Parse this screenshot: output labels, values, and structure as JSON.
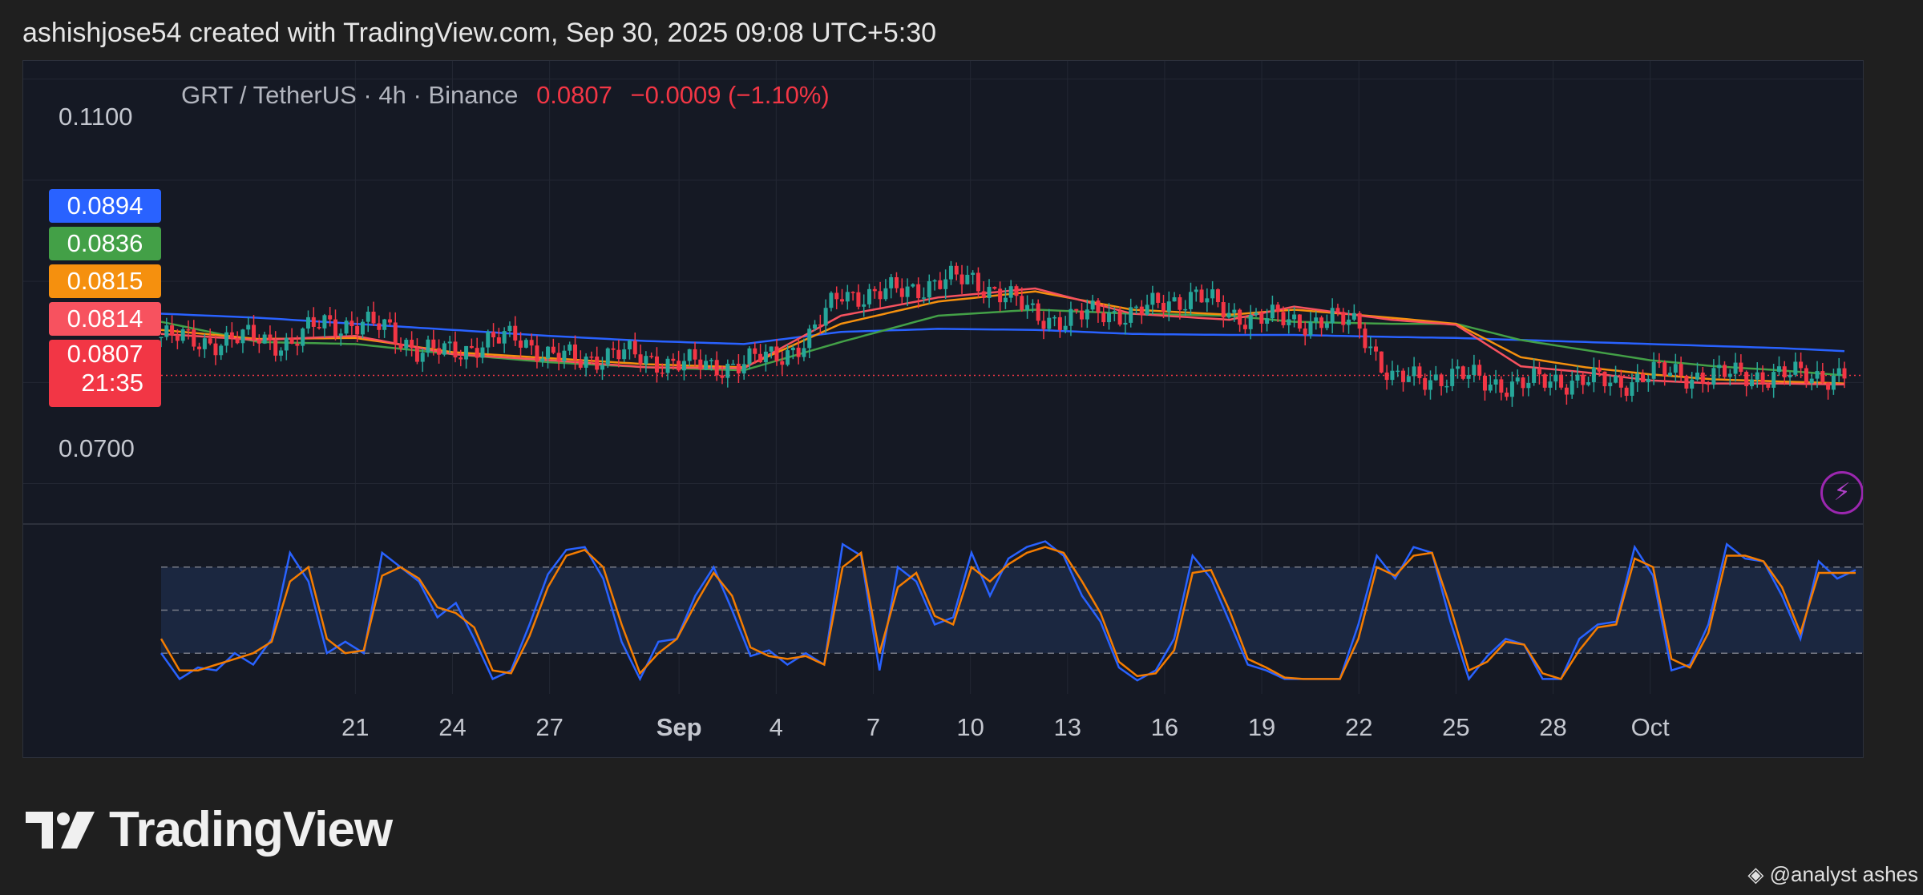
{
  "header": {
    "text": "ashishjose54 created with TradingView.com, Sep 30, 2025 09:08 UTC+5:30"
  },
  "legend": {
    "symbol": "GRT / TetherUS · 4h · Binance",
    "price": "0.0807",
    "change": "−0.0009 (−1.10%)"
  },
  "price_tags": [
    {
      "value": "0.0894",
      "color": "#2962ff"
    },
    {
      "value": "0.0836",
      "color": "#43a047"
    },
    {
      "value": "0.0815",
      "color": "#f5900e"
    },
    {
      "value": "0.0814",
      "color": "#f7525f"
    },
    {
      "value": "0.0807",
      "color": "#f23645"
    }
  ],
  "countdown": "21:35",
  "brand": {
    "name": "TradingView"
  },
  "credit": {
    "text": "@analyst ashes"
  },
  "icons": {
    "logo": "tradingview-logo-icon",
    "bolt": "lightning-icon",
    "credit": "binance-diamond-icon"
  },
  "colors": {
    "up": "#26a69a",
    "down": "#f23645",
    "k_line": "#2962ff",
    "d_line": "#f57c00"
  },
  "chart_data": [
    {
      "type": "candlestick",
      "title": "GRT / TetherUS · 4h · Binance",
      "x_ticks": [
        "21",
        "24",
        "27",
        "Sep",
        "4",
        "7",
        "10",
        "13",
        "16",
        "19",
        "22",
        "25",
        "28",
        "Oct"
      ],
      "x_ticks_bold": [
        "Sep"
      ],
      "y_ticks": [
        "0.1100",
        "0.0700"
      ],
      "ylim": [
        0.066,
        0.1118
      ],
      "last_price": 0.0807,
      "series": [
        {
          "name": "",
          "color": "#2962ff",
          "points": [
            [
              0,
              0.0868
            ],
            [
              3,
              0.0864
            ],
            [
              6,
              0.0858
            ],
            [
              9,
              0.0852
            ],
            [
              12,
              0.0846
            ],
            [
              15,
              0.0841
            ],
            [
              18,
              0.0838
            ],
            [
              21,
              0.085
            ],
            [
              24,
              0.0853
            ],
            [
              27,
              0.0852
            ],
            [
              30,
              0.0848
            ],
            [
              33,
              0.0847
            ],
            [
              35,
              0.0847
            ],
            [
              38,
              0.0845
            ],
            [
              40,
              0.0844
            ],
            [
              42,
              0.0842
            ],
            [
              44,
              0.084
            ],
            [
              46,
              0.0838
            ],
            [
              48,
              0.0836
            ],
            [
              50,
              0.0834
            ],
            [
              52,
              0.0831
            ]
          ]
        },
        {
          "name": "",
          "color": "#43a047",
          "points": [
            [
              0,
              0.086
            ],
            [
              3,
              0.084
            ],
            [
              6,
              0.0838
            ],
            [
              9,
              0.0828
            ],
            [
              12,
              0.082
            ],
            [
              15,
              0.0815
            ],
            [
              18,
              0.0812
            ],
            [
              21,
              0.084
            ],
            [
              24,
              0.0866
            ],
            [
              27,
              0.0872
            ],
            [
              30,
              0.0868
            ],
            [
              33,
              0.0866
            ],
            [
              35,
              0.086
            ],
            [
              38,
              0.0858
            ],
            [
              40,
              0.0858
            ],
            [
              42,
              0.0842
            ],
            [
              44,
              0.0832
            ],
            [
              46,
              0.0822
            ],
            [
              48,
              0.0816
            ],
            [
              50,
              0.0812
            ],
            [
              52,
              0.0807
            ]
          ]
        },
        {
          "name": "",
          "color": "#f5900e",
          "points": [
            [
              0,
              0.0852
            ],
            [
              3,
              0.0843
            ],
            [
              6,
              0.0844
            ],
            [
              9,
              0.083
            ],
            [
              12,
              0.0824
            ],
            [
              15,
              0.0818
            ],
            [
              18,
              0.0815
            ],
            [
              21,
              0.0858
            ],
            [
              24,
              0.088
            ],
            [
              27,
              0.089
            ],
            [
              30,
              0.0872
            ],
            [
              33,
              0.0867
            ],
            [
              35,
              0.0872
            ],
            [
              38,
              0.0864
            ],
            [
              40,
              0.0858
            ],
            [
              42,
              0.0825
            ],
            [
              44,
              0.0815
            ],
            [
              46,
              0.0808
            ],
            [
              48,
              0.0803
            ],
            [
              50,
              0.0801
            ],
            [
              52,
              0.0799
            ]
          ]
        },
        {
          "name": "",
          "color": "#f7525f",
          "points": [
            [
              0,
              0.0848
            ],
            [
              3,
              0.0842
            ],
            [
              6,
              0.0846
            ],
            [
              9,
              0.0828
            ],
            [
              12,
              0.0822
            ],
            [
              15,
              0.0815
            ],
            [
              18,
              0.0814
            ],
            [
              21,
              0.0866
            ],
            [
              24,
              0.0884
            ],
            [
              27,
              0.0893
            ],
            [
              30,
              0.0868
            ],
            [
              33,
              0.0862
            ],
            [
              35,
              0.0875
            ],
            [
              38,
              0.0862
            ],
            [
              40,
              0.0857
            ],
            [
              42,
              0.0816
            ],
            [
              44,
              0.081
            ],
            [
              46,
              0.0802
            ],
            [
              48,
              0.0799
            ],
            [
              50,
              0.0799
            ],
            [
              52,
              0.0798
            ]
          ]
        }
      ],
      "candles_close": [
        [
          0,
          0.0845
        ],
        [
          1,
          0.0842
        ],
        [
          2,
          0.084
        ],
        [
          3,
          0.0846
        ],
        [
          4,
          0.0836
        ],
        [
          5,
          0.0862
        ],
        [
          6,
          0.0855
        ],
        [
          7,
          0.0856
        ],
        [
          8,
          0.0828
        ],
        [
          9,
          0.0832
        ],
        [
          10,
          0.0838
        ],
        [
          11,
          0.0846
        ],
        [
          12,
          0.0826
        ],
        [
          13,
          0.0822
        ],
        [
          14,
          0.083
        ],
        [
          15,
          0.0822
        ],
        [
          16,
          0.082
        ],
        [
          17,
          0.0815
        ],
        [
          18,
          0.082
        ],
        [
          19,
          0.0826
        ],
        [
          20,
          0.0842
        ],
        [
          21,
          0.089
        ],
        [
          22,
          0.0885
        ],
        [
          23,
          0.0893
        ],
        [
          24,
          0.0898
        ],
        [
          25,
          0.0904
        ],
        [
          26,
          0.0886
        ],
        [
          27,
          0.0868
        ],
        [
          28,
          0.086
        ],
        [
          29,
          0.0872
        ],
        [
          30,
          0.0866
        ],
        [
          31,
          0.088
        ],
        [
          32,
          0.0886
        ],
        [
          33,
          0.0868
        ],
        [
          34,
          0.0864
        ],
        [
          35,
          0.086
        ],
        [
          36,
          0.0862
        ],
        [
          37,
          0.0858
        ],
        [
          38,
          0.0802
        ],
        [
          39,
          0.0804
        ],
        [
          40,
          0.0808
        ],
        [
          41,
          0.08
        ],
        [
          42,
          0.0798
        ],
        [
          43,
          0.0802
        ],
        [
          44,
          0.0803
        ],
        [
          45,
          0.0798
        ],
        [
          46,
          0.081
        ],
        [
          47,
          0.0807
        ]
      ]
    },
    {
      "type": "line",
      "title": "",
      "ylim": [
        0,
        100
      ],
      "bands": [
        20,
        50,
        80
      ],
      "series": [
        {
          "name": "",
          "color": "#2962ff",
          "values": [
            20,
            2,
            10,
            8,
            20,
            12,
            30,
            90,
            70,
            20,
            28,
            20,
            90,
            80,
            70,
            45,
            55,
            30,
            2,
            8,
            40,
            75,
            92,
            94,
            72,
            28,
            2,
            28,
            30,
            60,
            80,
            50,
            18,
            22,
            12,
            20,
            12,
            96,
            88,
            8,
            80,
            70,
            40,
            45,
            90,
            60,
            86,
            94,
            98,
            88,
            60,
            42,
            10,
            1,
            8,
            30,
            88,
            72,
            42,
            12,
            8,
            2,
            2,
            2,
            2,
            40,
            88,
            72,
            94,
            90,
            42,
            2,
            18,
            30,
            26,
            2,
            2,
            30,
            40,
            42,
            94,
            74,
            8,
            12,
            40,
            96,
            86,
            84,
            60,
            30,
            84,
            72,
            78
          ]
        },
        {
          "name": "",
          "color": "#f57c00",
          "values": [
            30,
            8,
            8,
            12,
            16,
            20,
            28,
            70,
            80,
            30,
            20,
            22,
            74,
            80,
            72,
            52,
            48,
            38,
            8,
            6,
            32,
            66,
            88,
            92,
            80,
            40,
            6,
            20,
            30,
            54,
            76,
            60,
            24,
            18,
            16,
            18,
            12,
            80,
            90,
            20,
            66,
            76,
            46,
            40,
            80,
            70,
            82,
            90,
            94,
            90,
            70,
            48,
            14,
            4,
            6,
            22,
            76,
            78,
            50,
            16,
            10,
            3,
            2,
            2,
            2,
            30,
            80,
            74,
            88,
            90,
            52,
            8,
            14,
            28,
            26,
            6,
            2,
            22,
            38,
            40,
            86,
            80,
            16,
            10,
            34,
            88,
            88,
            84,
            66,
            34,
            76,
            76,
            76
          ]
        }
      ]
    }
  ]
}
